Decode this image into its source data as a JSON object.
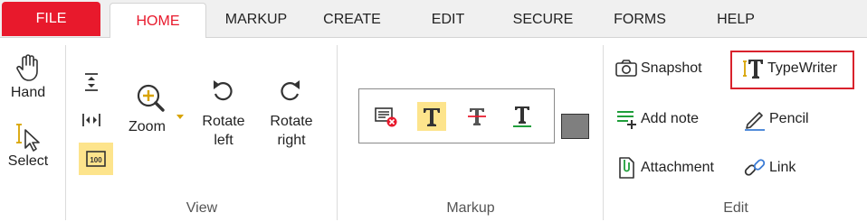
{
  "tabs": {
    "file": "FILE",
    "home": "HOME",
    "markup": "MARKUP",
    "create": "CREATE",
    "edit": "EDIT",
    "secure": "SECURE",
    "forms": "FORMS",
    "help": "HELP"
  },
  "tools": {
    "hand": "Hand",
    "select": "Select"
  },
  "view": {
    "zoom_line1": "Zoom",
    "rotate_left_line1": "Rotate",
    "rotate_left_line2": "left",
    "rotate_right_line1": "Rotate",
    "rotate_right_line2": "right",
    "actual_size_icon_text": "100",
    "group_label": "View"
  },
  "markup": {
    "group_label": "Markup",
    "swatch_color": "#7f7f7f"
  },
  "edit": {
    "snapshot": "Snapshot",
    "typewriter": "TypeWriter",
    "add_note": "Add note",
    "pencil": "Pencil",
    "attachment": "Attachment",
    "link": "Link",
    "group_label": "Edit"
  },
  "colors": {
    "accent": "#e8192c",
    "highlight": "#fde48c",
    "highlight_box": "#d9222c"
  }
}
